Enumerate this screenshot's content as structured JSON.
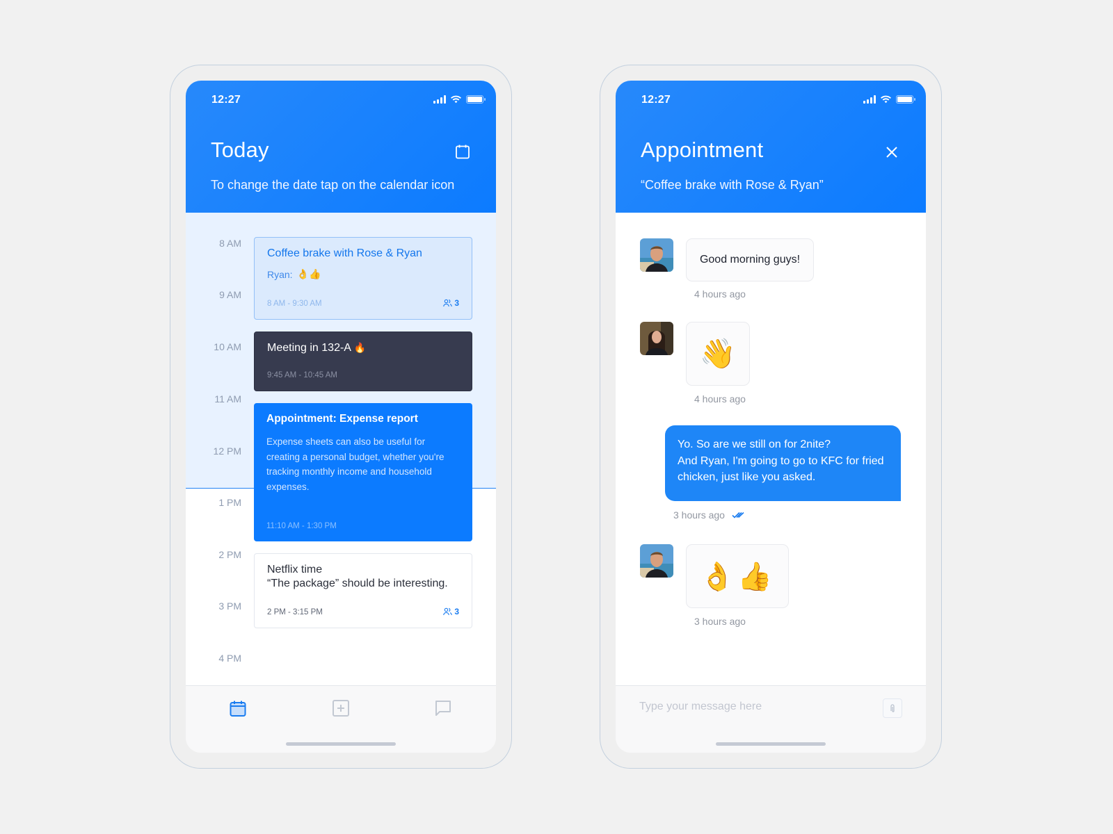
{
  "colors": {
    "brand_blue": "#0c7bff",
    "dark_event": "#373b4f",
    "past_tint": "#e8f2ff",
    "page_bg": "#f1f1f1"
  },
  "calendar_screen": {
    "status_bar": {
      "time": "12:27"
    },
    "header": {
      "title": "Today",
      "subtitle": "To change the date tap on the calendar icon",
      "action_icon": "calendar-icon"
    },
    "hours": [
      "8 AM",
      "9 AM",
      "10 AM",
      "11 AM",
      "12 PM",
      "1 PM",
      "2 PM",
      "3 PM",
      "4 PM"
    ],
    "events": [
      {
        "title": "Coffee brake with Rose & Ryan",
        "note_label": "Ryan:",
        "note_emoji": "👌👍",
        "time": "8 AM - 9:30 AM",
        "attendees": "3"
      },
      {
        "title": "Meeting in 132-A",
        "title_emoji": "🔥",
        "time": "9:45 AM - 10:45 AM"
      },
      {
        "title": "Appointment: Expense report",
        "description": "Expense sheets can also be useful for creating a personal budget, whether you're tracking monthly income and household expenses.",
        "time": "11:10 AM - 1:30 PM"
      },
      {
        "title_line1": "Netflix time",
        "title_line2": "“The package” should be interesting.",
        "time": "2 PM - 3:15 PM",
        "attendees": "3"
      }
    ],
    "bottom_nav": [
      {
        "icon": "calendar-icon",
        "active": true
      },
      {
        "icon": "add-square-icon",
        "active": false
      },
      {
        "icon": "chat-bubble-icon",
        "active": false
      }
    ]
  },
  "chat_screen": {
    "status_bar": {
      "time": "12:27"
    },
    "header": {
      "title": "Appointment",
      "subtitle": "“Coffee brake with Rose & Ryan”",
      "action_icon": "close-icon"
    },
    "messages": [
      {
        "sender": "other",
        "avatar": "man-avatar",
        "text": "Good morning guys!",
        "time": "4 hours ago"
      },
      {
        "sender": "other",
        "avatar": "woman-avatar",
        "emoji": "👋",
        "time": "4 hours ago"
      },
      {
        "sender": "me",
        "text_line1": "Yo. So are we still on for 2nite?",
        "text_line2": "And Ryan, I'm going to go to KFC for fried chicken, just like you asked.",
        "time": "3 hours ago",
        "status": "read"
      },
      {
        "sender": "other",
        "avatar": "man-avatar",
        "emoji": "👌👍",
        "time": "3 hours ago"
      }
    ],
    "input": {
      "placeholder": "Type your message here",
      "value": ""
    }
  }
}
